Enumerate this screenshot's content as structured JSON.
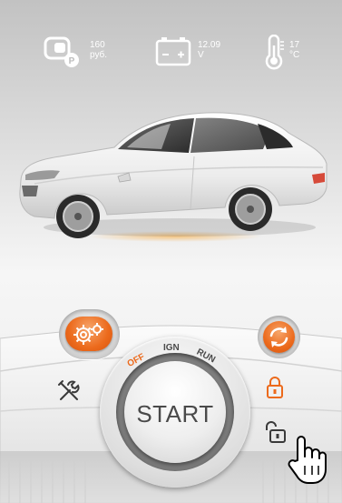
{
  "status": {
    "balance": {
      "value": "160",
      "unit": "руб.",
      "icon": "wallet-coin-icon"
    },
    "voltage": {
      "value": "12.09",
      "unit": "V",
      "icon": "battery-icon"
    },
    "temperature": {
      "value": "17",
      "unit": "°C",
      "icon": "thermometer-icon"
    }
  },
  "car": {
    "icon": "car-image"
  },
  "controls": {
    "start_label": "START",
    "positions": {
      "off": "OFF",
      "ign": "IGN",
      "run": "RUN"
    },
    "active_position": "OFF",
    "settings_icon": "gears-icon",
    "autostart_icon": "refresh-icon",
    "service_icon": "tools-icon",
    "lock_icon": "lock-closed-icon",
    "unlock_icon": "lock-open-icon"
  },
  "colors": {
    "accent": "#ec6a1c",
    "text_dark": "#4a4a4a"
  }
}
